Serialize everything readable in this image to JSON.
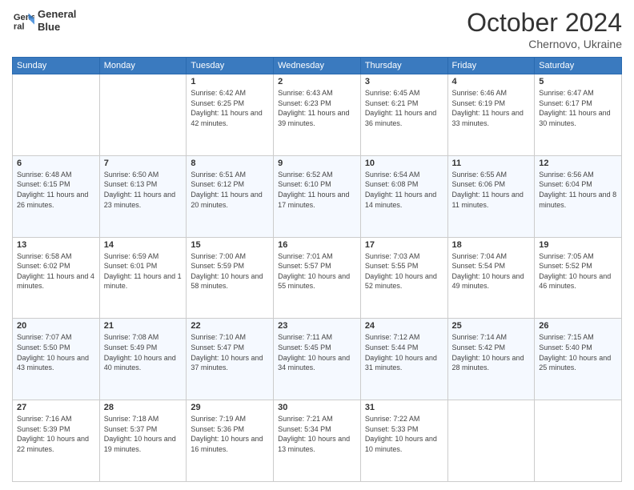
{
  "header": {
    "logo_line1": "General",
    "logo_line2": "Blue",
    "month": "October 2024",
    "location": "Chernovo, Ukraine"
  },
  "weekdays": [
    "Sunday",
    "Monday",
    "Tuesday",
    "Wednesday",
    "Thursday",
    "Friday",
    "Saturday"
  ],
  "weeks": [
    [
      {
        "day": "",
        "info": ""
      },
      {
        "day": "",
        "info": ""
      },
      {
        "day": "1",
        "info": "Sunrise: 6:42 AM\nSunset: 6:25 PM\nDaylight: 11 hours and 42 minutes."
      },
      {
        "day": "2",
        "info": "Sunrise: 6:43 AM\nSunset: 6:23 PM\nDaylight: 11 hours and 39 minutes."
      },
      {
        "day": "3",
        "info": "Sunrise: 6:45 AM\nSunset: 6:21 PM\nDaylight: 11 hours and 36 minutes."
      },
      {
        "day": "4",
        "info": "Sunrise: 6:46 AM\nSunset: 6:19 PM\nDaylight: 11 hours and 33 minutes."
      },
      {
        "day": "5",
        "info": "Sunrise: 6:47 AM\nSunset: 6:17 PM\nDaylight: 11 hours and 30 minutes."
      }
    ],
    [
      {
        "day": "6",
        "info": "Sunrise: 6:48 AM\nSunset: 6:15 PM\nDaylight: 11 hours and 26 minutes."
      },
      {
        "day": "7",
        "info": "Sunrise: 6:50 AM\nSunset: 6:13 PM\nDaylight: 11 hours and 23 minutes."
      },
      {
        "day": "8",
        "info": "Sunrise: 6:51 AM\nSunset: 6:12 PM\nDaylight: 11 hours and 20 minutes."
      },
      {
        "day": "9",
        "info": "Sunrise: 6:52 AM\nSunset: 6:10 PM\nDaylight: 11 hours and 17 minutes."
      },
      {
        "day": "10",
        "info": "Sunrise: 6:54 AM\nSunset: 6:08 PM\nDaylight: 11 hours and 14 minutes."
      },
      {
        "day": "11",
        "info": "Sunrise: 6:55 AM\nSunset: 6:06 PM\nDaylight: 11 hours and 11 minutes."
      },
      {
        "day": "12",
        "info": "Sunrise: 6:56 AM\nSunset: 6:04 PM\nDaylight: 11 hours and 8 minutes."
      }
    ],
    [
      {
        "day": "13",
        "info": "Sunrise: 6:58 AM\nSunset: 6:02 PM\nDaylight: 11 hours and 4 minutes."
      },
      {
        "day": "14",
        "info": "Sunrise: 6:59 AM\nSunset: 6:01 PM\nDaylight: 11 hours and 1 minute."
      },
      {
        "day": "15",
        "info": "Sunrise: 7:00 AM\nSunset: 5:59 PM\nDaylight: 10 hours and 58 minutes."
      },
      {
        "day": "16",
        "info": "Sunrise: 7:01 AM\nSunset: 5:57 PM\nDaylight: 10 hours and 55 minutes."
      },
      {
        "day": "17",
        "info": "Sunrise: 7:03 AM\nSunset: 5:55 PM\nDaylight: 10 hours and 52 minutes."
      },
      {
        "day": "18",
        "info": "Sunrise: 7:04 AM\nSunset: 5:54 PM\nDaylight: 10 hours and 49 minutes."
      },
      {
        "day": "19",
        "info": "Sunrise: 7:05 AM\nSunset: 5:52 PM\nDaylight: 10 hours and 46 minutes."
      }
    ],
    [
      {
        "day": "20",
        "info": "Sunrise: 7:07 AM\nSunset: 5:50 PM\nDaylight: 10 hours and 43 minutes."
      },
      {
        "day": "21",
        "info": "Sunrise: 7:08 AM\nSunset: 5:49 PM\nDaylight: 10 hours and 40 minutes."
      },
      {
        "day": "22",
        "info": "Sunrise: 7:10 AM\nSunset: 5:47 PM\nDaylight: 10 hours and 37 minutes."
      },
      {
        "day": "23",
        "info": "Sunrise: 7:11 AM\nSunset: 5:45 PM\nDaylight: 10 hours and 34 minutes."
      },
      {
        "day": "24",
        "info": "Sunrise: 7:12 AM\nSunset: 5:44 PM\nDaylight: 10 hours and 31 minutes."
      },
      {
        "day": "25",
        "info": "Sunrise: 7:14 AM\nSunset: 5:42 PM\nDaylight: 10 hours and 28 minutes."
      },
      {
        "day": "26",
        "info": "Sunrise: 7:15 AM\nSunset: 5:40 PM\nDaylight: 10 hours and 25 minutes."
      }
    ],
    [
      {
        "day": "27",
        "info": "Sunrise: 7:16 AM\nSunset: 5:39 PM\nDaylight: 10 hours and 22 minutes."
      },
      {
        "day": "28",
        "info": "Sunrise: 7:18 AM\nSunset: 5:37 PM\nDaylight: 10 hours and 19 minutes."
      },
      {
        "day": "29",
        "info": "Sunrise: 7:19 AM\nSunset: 5:36 PM\nDaylight: 10 hours and 16 minutes."
      },
      {
        "day": "30",
        "info": "Sunrise: 7:21 AM\nSunset: 5:34 PM\nDaylight: 10 hours and 13 minutes."
      },
      {
        "day": "31",
        "info": "Sunrise: 7:22 AM\nSunset: 5:33 PM\nDaylight: 10 hours and 10 minutes."
      },
      {
        "day": "",
        "info": ""
      },
      {
        "day": "",
        "info": ""
      }
    ]
  ]
}
